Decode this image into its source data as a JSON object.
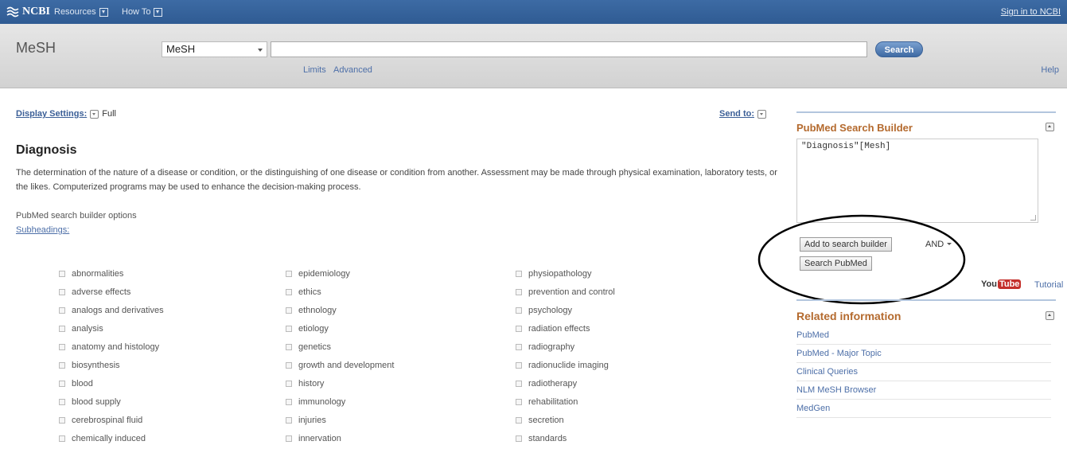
{
  "topbar": {
    "logo_text": "NCBI",
    "resources_label": "Resources",
    "howto_label": "How To",
    "signin_label": "Sign in to NCBI"
  },
  "search": {
    "db_title": "MeSH",
    "db_selected": "MeSH",
    "query_value": "",
    "button_label": "Search",
    "limits_label": "Limits",
    "advanced_label": "Advanced",
    "help_label": "Help"
  },
  "content": {
    "display_settings_label": "Display Settings:",
    "display_settings_value": "Full",
    "send_to_label": "Send to:",
    "heading": "Diagnosis",
    "description": "The determination of the nature of a disease or condition, or the distinguishing of one disease or condition from another. Assessment may be made through physical examination, laboratory tests, or the likes. Computerized programs may be used to enhance the decision-making process.",
    "builder_options_label": "PubMed search builder options",
    "subheadings_label": "Subheadings:",
    "subheadings": {
      "col1": [
        "abnormalities",
        "adverse effects",
        "analogs and derivatives",
        "analysis",
        "anatomy and histology",
        "biosynthesis",
        "blood",
        "blood supply",
        "cerebrospinal fluid",
        "chemically induced"
      ],
      "col2": [
        "epidemiology",
        "ethics",
        "ethnology",
        "etiology",
        "genetics",
        "growth and development",
        "history",
        "immunology",
        "injuries",
        "innervation"
      ],
      "col3": [
        "physiopathology",
        "prevention and control",
        "psychology",
        "radiation effects",
        "radiography",
        "radionuclide imaging",
        "radiotherapy",
        "rehabilitation",
        "secretion",
        "standards"
      ]
    }
  },
  "sidebar": {
    "builder_title": "PubMed Search Builder",
    "builder_query": "\"Diagnosis\"[Mesh]",
    "add_button_label": "Add to search builder",
    "operator_value": "AND",
    "search_pubmed_label": "Search PubMed",
    "youtube_you": "You",
    "youtube_tube": "Tube",
    "tutorial_label": "Tutorial",
    "related_title": "Related information",
    "related_items": [
      "PubMed",
      "PubMed - Major Topic",
      "Clinical Queries",
      "NLM MeSH Browser",
      "MedGen"
    ]
  },
  "colors": {
    "topbar": "#34619a",
    "link": "#4d6fa8",
    "sidebar_heading": "#b46a2e",
    "search_button": "#5c84b8",
    "youtube_red": "#c4302b"
  }
}
